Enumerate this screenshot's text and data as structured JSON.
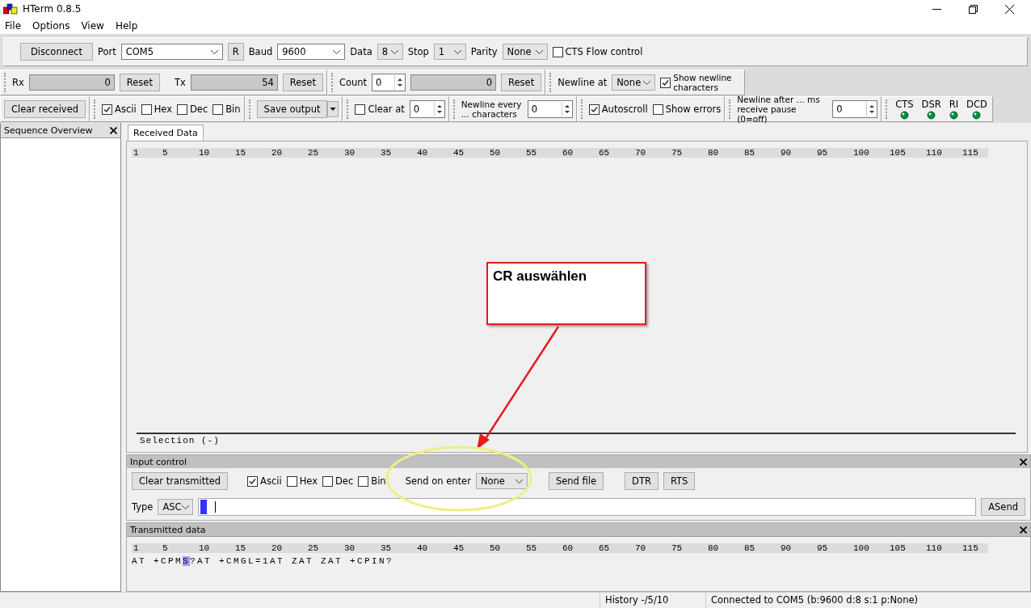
{
  "window": {
    "title": "HTerm 0.8.5"
  },
  "menu": [
    "File",
    "Options",
    "View",
    "Help"
  ],
  "connection": {
    "disconnect": "Disconnect",
    "port_label": "Port",
    "port": "COM5",
    "refresh": "R",
    "baud_label": "Baud",
    "baud": "9600",
    "data_label": "Data",
    "data": "8",
    "stop_label": "Stop",
    "stop": "1",
    "parity_label": "Parity",
    "parity": "None",
    "cts_flow": {
      "label": "CTS Flow control",
      "checked": false
    }
  },
  "counters": {
    "rx_label": "Rx",
    "rx": "0",
    "rx_reset": "Reset",
    "tx_label": "Tx",
    "tx": "54",
    "tx_reset": "Reset",
    "count_label": "Count",
    "count": "0",
    "count_value": "0",
    "count_reset": "Reset",
    "newline_at_label": "Newline at",
    "newline_at": "None",
    "show_newline": {
      "label": "Show newline characters",
      "checked": true
    }
  },
  "receive_options": {
    "clear_received": "Clear received",
    "formats": [
      {
        "label": "Ascii",
        "checked": true
      },
      {
        "label": "Hex",
        "checked": false
      },
      {
        "label": "Dec",
        "checked": false
      },
      {
        "label": "Bin",
        "checked": false
      }
    ],
    "save_output": "Save output",
    "clear_at": {
      "label": "Clear at",
      "checked": false,
      "value": "0"
    },
    "newline_every": {
      "label": "Newline every ... characters",
      "value": "0"
    },
    "autoscroll": {
      "label": "Autoscroll",
      "checked": true
    },
    "show_errors": {
      "label": "Show errors",
      "checked": false
    },
    "newline_after": {
      "label": "Newline after ... ms receive pause (0=off)",
      "value": "0"
    },
    "signals": [
      "CTS",
      "DSR",
      "RI",
      "DCD"
    ]
  },
  "sequence_overview": {
    "title": "Sequence Overview"
  },
  "received": {
    "tab": {
      "label": "Received Data",
      "selected": true
    },
    "ruler": [
      "1",
      "5",
      "10",
      "15",
      "20",
      "25",
      "30",
      "35",
      "40",
      "45",
      "50",
      "55",
      "60",
      "65",
      "70",
      "75",
      "80",
      "85",
      "90",
      "95",
      "100",
      "105",
      "110",
      "115"
    ],
    "selection": "Selection (-)"
  },
  "input_control": {
    "title": "Input control",
    "clear_transmitted": "Clear transmitted",
    "formats": [
      {
        "label": "Ascii",
        "checked": true
      },
      {
        "label": "Hex",
        "checked": false
      },
      {
        "label": "Dec",
        "checked": false
      },
      {
        "label": "Bin",
        "checked": false
      }
    ],
    "send_on_enter_label": "Send on enter",
    "send_on_enter": "None",
    "send_file": "Send file",
    "dtr": "DTR",
    "rts": "RTS",
    "type_label": "Type",
    "type": "ASC",
    "asend": "ASend"
  },
  "transmitted": {
    "title": "Transmitted data",
    "ruler": [
      "1",
      "5",
      "10",
      "15",
      "20",
      "25",
      "30",
      "35",
      "40",
      "45",
      "50",
      "55",
      "60",
      "65",
      "70",
      "75",
      "80",
      "85",
      "90",
      "95",
      "100",
      "105",
      "110",
      "115"
    ],
    "text": {
      "before": "AT +CPM",
      "highlighted": "S",
      "after": "?AT +CMGL=1AT ZAT ZAT +CPIN?"
    }
  },
  "status_bar": {
    "history": "History -/5/10",
    "connection": "Connected to COM5 (b:9600 d:8 s:1 p:None)"
  },
  "annotation": {
    "text": "CR auswählen"
  }
}
